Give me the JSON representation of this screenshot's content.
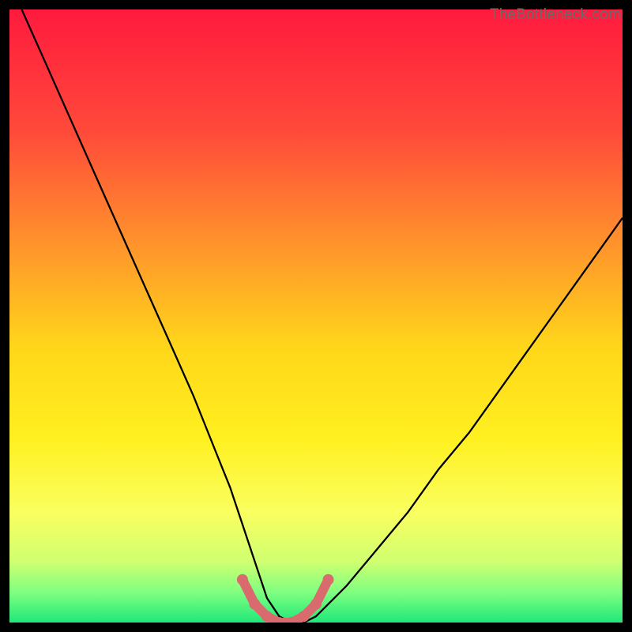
{
  "watermark": "TheBottleneck.com",
  "chart_data": {
    "type": "line",
    "title": "",
    "xlabel": "",
    "ylabel": "",
    "xlim": [
      0,
      100
    ],
    "ylim": [
      0,
      100
    ],
    "series": [
      {
        "name": "bottleneck-curve",
        "x": [
          2,
          6,
          10,
          14,
          18,
          22,
          26,
          30,
          34,
          36,
          38,
          40,
          42,
          44,
          46,
          48,
          50,
          55,
          60,
          65,
          70,
          75,
          80,
          85,
          90,
          95,
          100
        ],
        "values": [
          100,
          91,
          82,
          73,
          64,
          55,
          46,
          37,
          27,
          22,
          16,
          10,
          4,
          1,
          0,
          0,
          1,
          6,
          12,
          18,
          25,
          31,
          38,
          45,
          52,
          59,
          66
        ]
      },
      {
        "name": "optimal-marker",
        "x": [
          38,
          40,
          42,
          44,
          46,
          48,
          50,
          52
        ],
        "values": [
          7,
          3,
          1,
          0,
          0,
          1,
          3,
          7
        ]
      }
    ],
    "gradient_stops": [
      {
        "offset": 0.0,
        "color": "#ff1a3e"
      },
      {
        "offset": 0.2,
        "color": "#ff4a3a"
      },
      {
        "offset": 0.4,
        "color": "#ff9a2a"
      },
      {
        "offset": 0.55,
        "color": "#ffd61a"
      },
      {
        "offset": 0.7,
        "color": "#fff020"
      },
      {
        "offset": 0.82,
        "color": "#faff60"
      },
      {
        "offset": 0.9,
        "color": "#d0ff70"
      },
      {
        "offset": 0.95,
        "color": "#80ff80"
      },
      {
        "offset": 1.0,
        "color": "#20e87a"
      }
    ]
  }
}
